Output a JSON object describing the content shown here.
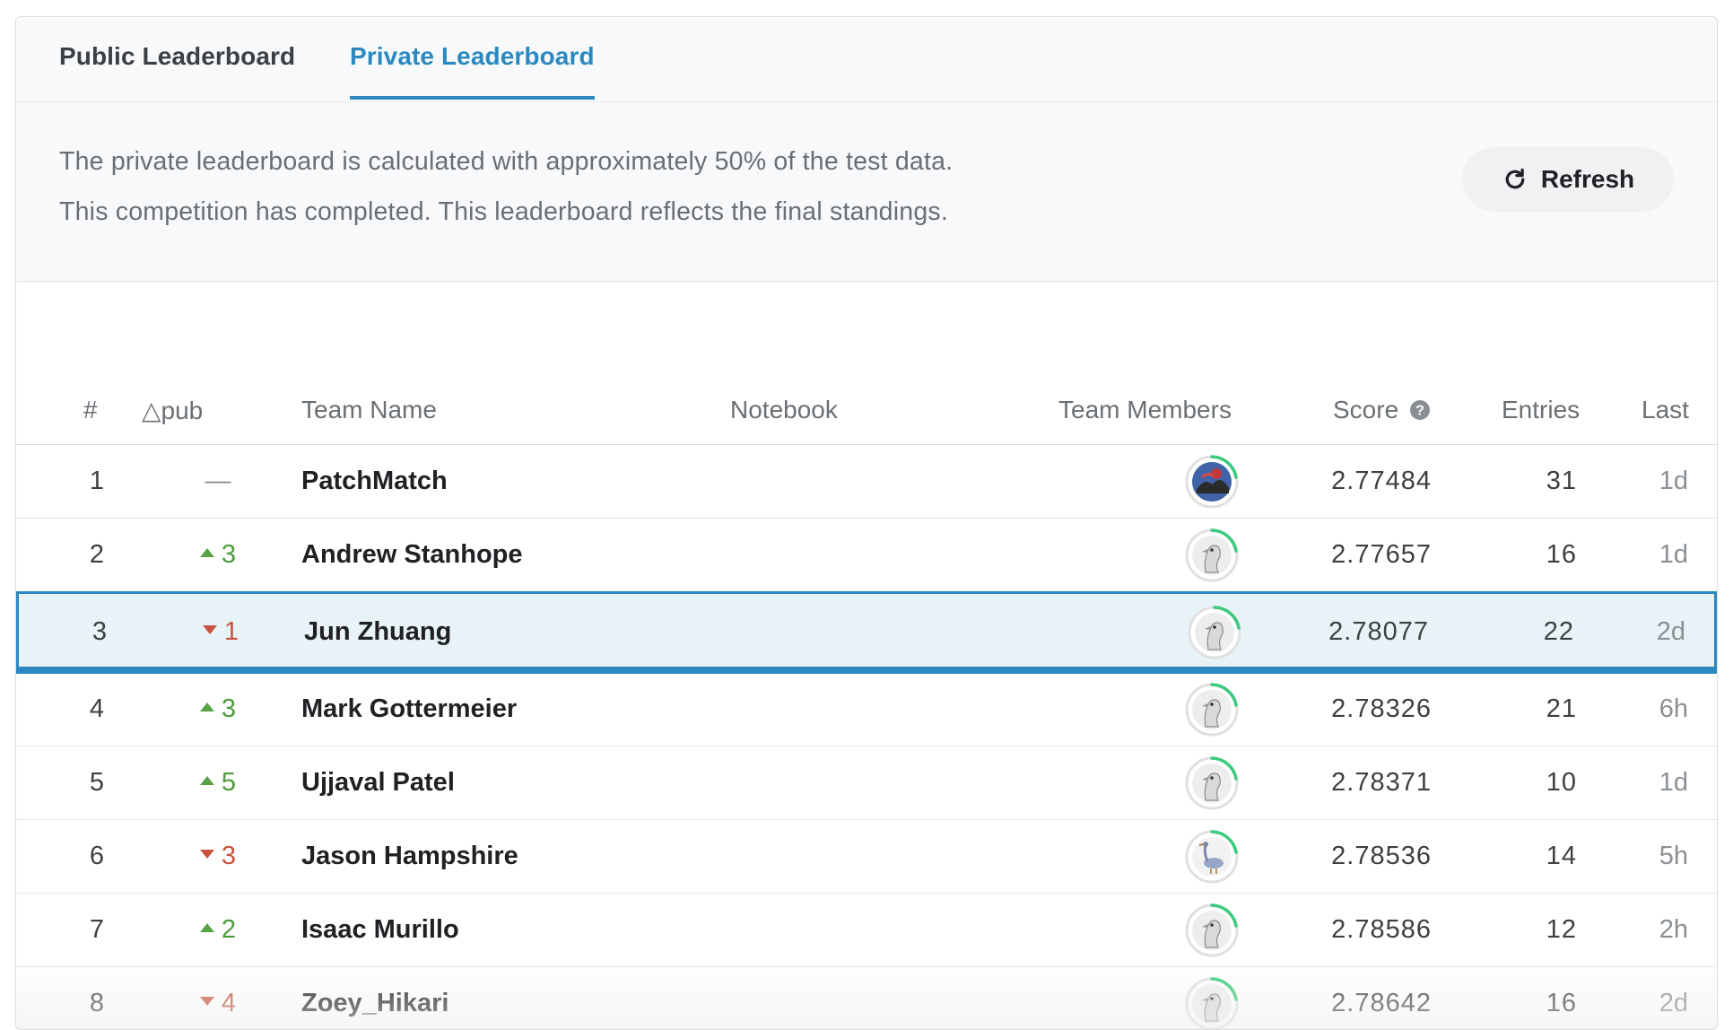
{
  "tabs": [
    {
      "label": "Public Leaderboard",
      "active": false
    },
    {
      "label": "Private Leaderboard",
      "active": true
    }
  ],
  "info": {
    "line1": "The private leaderboard is calculated with approximately 50% of the test data.",
    "line2": "This competition has completed. This leaderboard reflects the final standings.",
    "refresh_label": "Refresh"
  },
  "columns": {
    "rank": "#",
    "delta": "△pub",
    "team": "Team Name",
    "notebook": "Notebook",
    "members": "Team Members",
    "score": "Score",
    "entries": "Entries",
    "last": "Last"
  },
  "rows": [
    {
      "rank": "1",
      "delta": "—",
      "dir": "flat",
      "team": "PatchMatch",
      "score": "2.77484",
      "entries": "31",
      "last": "1d",
      "avatar": "photo"
    },
    {
      "rank": "2",
      "delta": "3",
      "dir": "up",
      "team": "Andrew Stanhope",
      "score": "2.77657",
      "entries": "16",
      "last": "1d",
      "avatar": "goose-head"
    },
    {
      "rank": "3",
      "delta": "1",
      "dir": "down",
      "team": "Jun Zhuang",
      "score": "2.78077",
      "entries": "22",
      "last": "2d",
      "avatar": "goose-head",
      "selected": true
    },
    {
      "rank": "4",
      "delta": "3",
      "dir": "up",
      "team": "Mark Gottermeier",
      "score": "2.78326",
      "entries": "21",
      "last": "6h",
      "avatar": "goose-head"
    },
    {
      "rank": "5",
      "delta": "5",
      "dir": "up",
      "team": "Ujjaval Patel",
      "score": "2.78371",
      "entries": "10",
      "last": "1d",
      "avatar": "goose-head"
    },
    {
      "rank": "6",
      "delta": "3",
      "dir": "down",
      "team": "Jason Hampshire",
      "score": "2.78536",
      "entries": "14",
      "last": "5h",
      "avatar": "goose-full"
    },
    {
      "rank": "7",
      "delta": "2",
      "dir": "up",
      "team": "Isaac Murillo",
      "score": "2.78586",
      "entries": "12",
      "last": "2h",
      "avatar": "goose-head"
    },
    {
      "rank": "8",
      "delta": "4",
      "dir": "down",
      "team": "Zoey_Hikari",
      "score": "2.78642",
      "entries": "16",
      "last": "2d",
      "avatar": "goose-head"
    }
  ],
  "colors": {
    "accent": "#2b89bf",
    "up": "#4f9a3e",
    "down": "#c9533f",
    "selected_bg": "#e8f3f7",
    "progress_ring": "#3ccb7f"
  }
}
